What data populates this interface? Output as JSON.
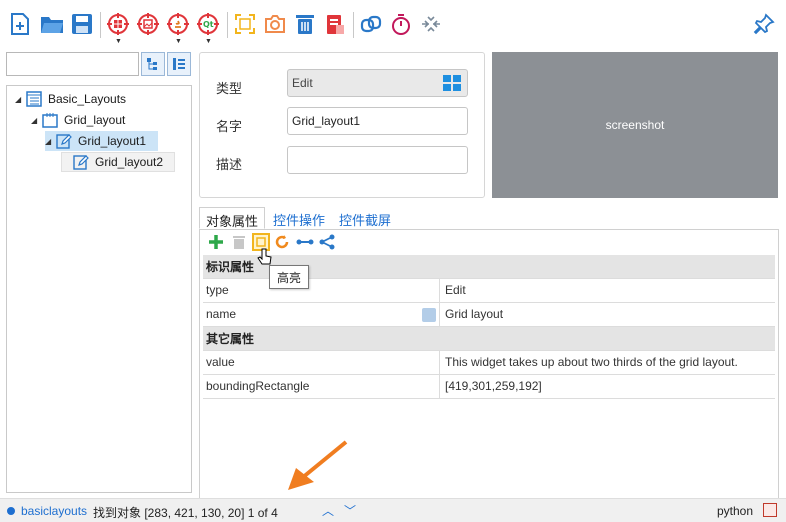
{
  "toolbar": {
    "icons": [
      "new-file-icon",
      "open-folder-icon",
      "save-icon",
      "windows-target-icon",
      "image-target-icon",
      "java-target-icon",
      "qt-target-icon",
      "highlight-frame-icon",
      "camera-icon",
      "trash-icon",
      "clipboard-icon",
      "link-icon",
      "timer-icon",
      "collapse-icon",
      "pin-icon"
    ]
  },
  "tree": {
    "items": [
      {
        "label": "Basic_Layouts",
        "icon": "layout-icon"
      },
      {
        "label": "Grid_layout",
        "icon": "grid-icon"
      },
      {
        "label": "Grid_layout1",
        "icon": "edit-icon"
      },
      {
        "label": "Grid_layout2",
        "icon": "edit-icon"
      }
    ]
  },
  "props": {
    "type_label": "类型",
    "type_value": "Edit",
    "name_label": "名字",
    "name_value": "Grid_layout1",
    "desc_label": "描述",
    "desc_value": ""
  },
  "screenshot": {
    "label": "screenshot"
  },
  "tabs": [
    "对象属性",
    "控件操作",
    "控件截屏"
  ],
  "tooltip": "高亮",
  "grid": {
    "section1": "标识属性",
    "rows1": [
      {
        "key": "type",
        "value": "Edit"
      },
      {
        "key": "name",
        "value": "Grid layout"
      }
    ],
    "section2": "其它属性",
    "rows2": [
      {
        "key": "value",
        "value": "This widget takes up about two thirds of the grid layout."
      },
      {
        "key": "boundingRectangle",
        "value": "[419,301,259,192]"
      }
    ]
  },
  "status": {
    "model": "basiclayouts",
    "found": "找到对象 [283, 421, 130, 20] 1 of 4",
    "lang": "python"
  },
  "colors": {
    "accent": "#1e6fd0",
    "screenshot_bg": "#8c9095",
    "arrow": "#f07d20"
  }
}
